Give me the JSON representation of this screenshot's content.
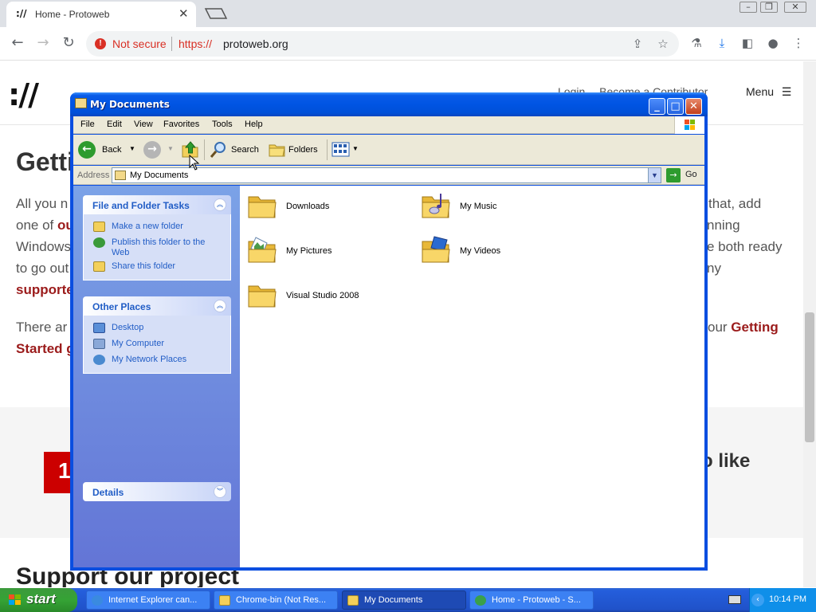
{
  "browser": {
    "tab_title": "Home - Protoweb",
    "tab_favicon": "://",
    "not_secure_label": "Not secure",
    "url_scheme": "https://",
    "url_host": "protoweb.org"
  },
  "website": {
    "logo": "://",
    "nav_login": "Login",
    "nav_contributor": "Become a Contributor",
    "nav_menu": "Menu",
    "heading_fragment": "Getti",
    "para1_line1_left": "All you n",
    "para1_line1_right": "that, add",
    "para1_line2_left": "one of ",
    "para1_line2_link": "ou",
    "para1_line2_right": "nning",
    "para1_line3_left": "Windows",
    "para1_line3_right": "e both ready",
    "para1_line4_left": "to go out",
    "para1_line4_right": "ny",
    "para1_line5_link": "supporte",
    "para2_line1_left": "There ar",
    "para2_line1_right": "our ",
    "para2_line1_link": "Getting",
    "para2_line2_link": "Started g",
    "badge_number": "1",
    "band_text_right": "o like",
    "support_heading": "Support our project"
  },
  "explorer": {
    "title": "My Documents",
    "menu": [
      "File",
      "Edit",
      "View",
      "Favorites",
      "Tools",
      "Help"
    ],
    "toolbar": {
      "back": "Back",
      "search": "Search",
      "folders": "Folders"
    },
    "address_label": "Address",
    "address_value": "My Documents",
    "go_label": "Go",
    "panels": {
      "file_tasks": {
        "title": "File and Folder Tasks",
        "items": [
          "Make a new folder",
          "Publish this folder to the Web",
          "Share this folder"
        ]
      },
      "other_places": {
        "title": "Other Places",
        "items": [
          "Desktop",
          "My Computer",
          "My Network Places"
        ]
      },
      "details": {
        "title": "Details"
      }
    },
    "folders": [
      "Downloads",
      "My Music",
      "My Pictures",
      "My Videos",
      "Visual Studio 2008"
    ]
  },
  "taskbar": {
    "start_label": "start",
    "tasks": [
      "Internet Explorer can...",
      "Chrome-bin (Not Res...",
      "My Documents",
      "Home - Protoweb - S..."
    ],
    "clock": "10:14 PM"
  },
  "colors": {
    "xp_blue": "#0054e3",
    "link_red": "#9b1b1b",
    "task_link": "#215dc6"
  }
}
